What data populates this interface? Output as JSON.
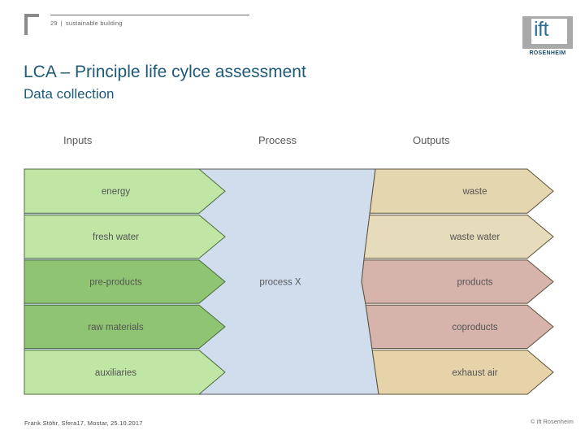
{
  "header": {
    "page_number": "29",
    "separator": "|",
    "section": "sustainable building",
    "corner_mark_icon": "corner-bracket-icon"
  },
  "logo": {
    "mark": "ift",
    "city": "ROSENHEIM",
    "mark_color": "#2f6f91",
    "city_color": "#1d4f6b",
    "block_color": "#a9a9a9"
  },
  "slide": {
    "title": "LCA – Principle life cylce assessment",
    "subtitle": "Data collection",
    "title_color": "#1d5a78"
  },
  "columns": {
    "inputs_label": "Inputs",
    "process_label": "Process",
    "outputs_label": "Outputs",
    "label_color": "#595959"
  },
  "diagram": {
    "process": {
      "label": "process X",
      "fill": "#cfdded",
      "stroke": "#555555"
    },
    "inputs": [
      {
        "label": "energy",
        "fill": "#bfe6a4",
        "stroke": "#4a6b3c"
      },
      {
        "label": "fresh water",
        "fill": "#bfe6a4",
        "stroke": "#4a6b3c"
      },
      {
        "label": "pre-products",
        "fill": "#8fc472",
        "stroke": "#4a6b3c"
      },
      {
        "label": "raw materials",
        "fill": "#8fc472",
        "stroke": "#4a6b3c"
      },
      {
        "label": "auxiliaries",
        "fill": "#bfe6a4",
        "stroke": "#4a6b3c"
      }
    ],
    "outputs": [
      {
        "label": "waste",
        "fill": "#e4d6ae",
        "stroke": "#5c513a"
      },
      {
        "label": "waste water",
        "fill": "#e6dcbb",
        "stroke": "#5c513a"
      },
      {
        "label": "products",
        "fill": "#d6b3ab",
        "stroke": "#5c513a"
      },
      {
        "label": "coproducts",
        "fill": "#d6b3ab",
        "stroke": "#5c513a"
      },
      {
        "label": "exhaust air",
        "fill": "#e6d3a9",
        "stroke": "#5c513a"
      }
    ]
  },
  "footer": {
    "author_line": "Frank Stöhr, Sfera17, Mostar, 25.10.2017",
    "copyright": "© ift Rosenheim"
  }
}
